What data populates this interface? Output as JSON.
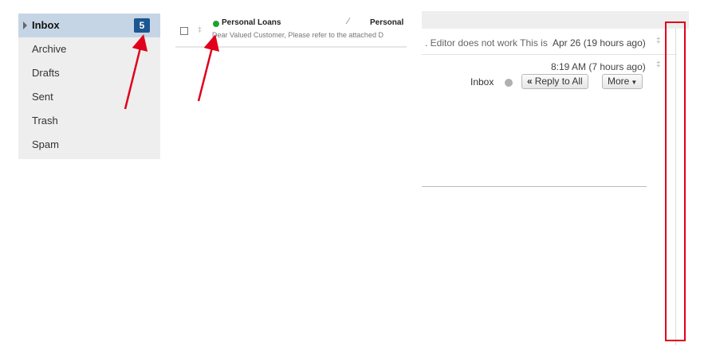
{
  "folders": {
    "items": [
      {
        "label": "Inbox",
        "badge": "5"
      },
      {
        "label": "Archive"
      },
      {
        "label": "Drafts"
      },
      {
        "label": "Sent"
      },
      {
        "label": "Trash"
      },
      {
        "label": "Spam"
      }
    ]
  },
  "message_list": {
    "row": {
      "sender": "Personal Loans",
      "subject": "Personal",
      "preview": "Dear Valued Customer, Please refer to the attached D"
    }
  },
  "reading_pane": {
    "thread_snippet": ". Editor does not work This is",
    "thread_date": "Apr 26 (19 hours ago)",
    "message_time": "8:19 AM (7 hours ago)",
    "folder_label": "Inbox",
    "reply_all_label": "Reply to All",
    "more_label": "More"
  },
  "colors": {
    "accent": "#1c5690",
    "active_folder_bg": "#c6d5e6",
    "unread_dot": "#21a02e",
    "annotation_red": "#e0001b"
  },
  "icons": [
    "caret-right-icon",
    "checkbox-icon",
    "pin-icon",
    "status-dot-icon",
    "paperclip-icon",
    "reply-all-icon",
    "chevron-down-icon"
  ]
}
